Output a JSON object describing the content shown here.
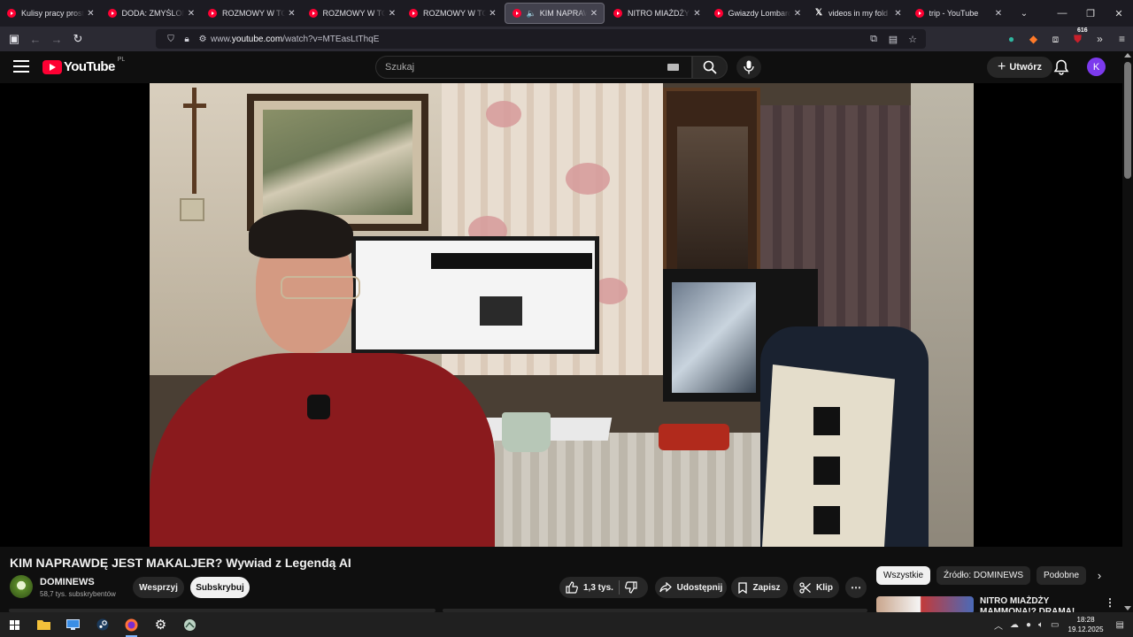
{
  "browser": {
    "tabs": [
      {
        "label": "Kulisy pracy prostytu",
        "icon": "youtube-icon",
        "active": false
      },
      {
        "label": "DODA: ZMYŚLONE ZI",
        "icon": "youtube-icon",
        "active": false
      },
      {
        "label": "ROZMOWY W TOKU",
        "icon": "youtube-icon",
        "active": false
      },
      {
        "label": "ROZMOWY W TOKU",
        "icon": "youtube-icon",
        "active": false
      },
      {
        "label": "ROZMOWY W TOKU",
        "icon": "youtube-icon",
        "active": false
      },
      {
        "label": "KIM NAPRAWDĘ",
        "icon": "youtube-icon",
        "active": true,
        "playing_audio": true
      },
      {
        "label": "NITRO MIAŻDŻY MA",
        "icon": "youtube-icon",
        "active": false
      },
      {
        "label": "Gwiazdy Lombardu: N",
        "icon": "youtube-icon",
        "active": false
      },
      {
        "label": "videos in my fold",
        "icon": "x-icon",
        "active": false
      },
      {
        "label": "trip - YouTube",
        "icon": "youtube-icon",
        "active": false
      }
    ],
    "url_prefix": "www.",
    "url_domain": "youtube.com",
    "url_path": "/watch?v=MTEasLtThqE",
    "extension_badge": "616"
  },
  "youtube": {
    "logo_text": "YouTube",
    "country_code": "PL",
    "search_placeholder": "Szukaj",
    "create_label": "Utwórz",
    "avatar_letter": "K",
    "accent_color": "#ff0033"
  },
  "video": {
    "title": "KIM NAPRAWDĘ JEST MAKALJER? Wywiad z Legendą AI",
    "channel": "DOMINEWS",
    "subscribers": "58,7 tys. subskrybentów",
    "support_label": "Wesprzyj",
    "subscribe_label": "Subskrybuj",
    "likes": "1,3 tys.",
    "share_label": "Udostępnij",
    "save_label": "Zapisz",
    "clip_label": "Klip"
  },
  "sidebar": {
    "chips": [
      "Wszystkie",
      "Źródło: DOMINEWS",
      "Podobne"
    ],
    "selected_chip": "Wszystkie",
    "recommendation_title": "NITRO MIAŻDŻY MAMMONA!? DRAMA! BRUCE DEBATA Z"
  },
  "taskbar": {
    "time": "18:28",
    "date": "19.12.2025"
  }
}
